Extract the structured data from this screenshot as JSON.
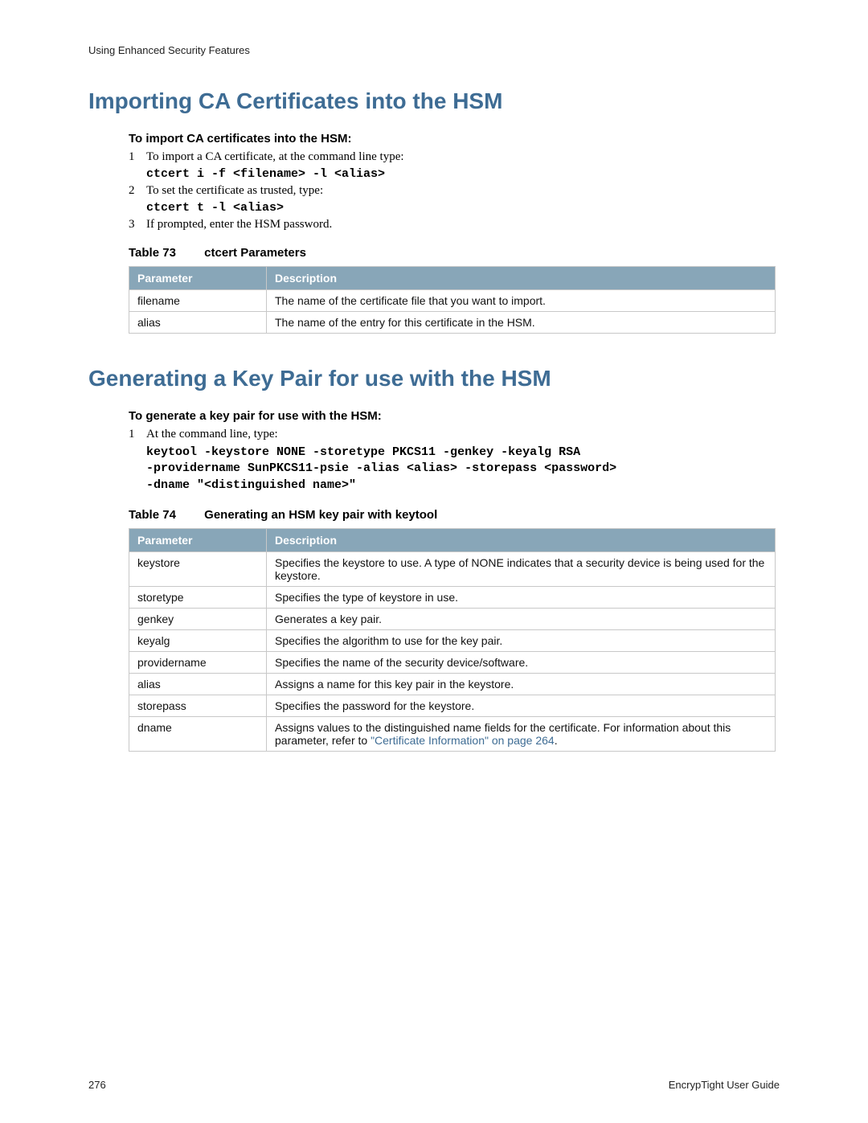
{
  "header": "Using Enhanced Security Features",
  "section1": {
    "title": "Importing CA Certificates into the HSM",
    "intro": "To import CA certificates into the HSM:",
    "steps": [
      {
        "n": "1",
        "text": "To import a CA certificate, at the command line type:"
      },
      {
        "n": "2",
        "text": "To set the certificate as trusted, type:"
      },
      {
        "n": "3",
        "text": "If prompted, enter the HSM password."
      }
    ],
    "code1": "ctcert i -f <filename> -l <alias>",
    "code2": "ctcert t -l <alias>",
    "tableCaptionNum": "Table 73",
    "tableCaptionText": "ctcert Parameters",
    "th1": "Parameter",
    "th2": "Description",
    "rows": [
      {
        "p": "filename",
        "d": "The name of the certificate file that you want to import."
      },
      {
        "p": "alias",
        "d": "The name of the entry for this certificate in the HSM."
      }
    ]
  },
  "section2": {
    "title": "Generating a Key Pair for use with the HSM",
    "intro": "To generate a key pair for use with the HSM:",
    "step1n": "1",
    "step1text": "At the command line, type:",
    "code": "keytool -keystore NONE -storetype PKCS11 -genkey -keyalg RSA\n-providername SunPKCS11-psie -alias <alias> -storepass <password>\n-dname \"<distinguished name>\"",
    "tableCaptionNum": "Table 74",
    "tableCaptionText": "Generating an HSM key pair with keytool",
    "th1": "Parameter",
    "th2": "Description",
    "rows": [
      {
        "p": "keystore",
        "d": "Specifies the keystore to use. A type of NONE indicates that a security device is being used for the keystore."
      },
      {
        "p": "storetype",
        "d": "Specifies the type of keystore in use."
      },
      {
        "p": "genkey",
        "d": "Generates a key pair."
      },
      {
        "p": "keyalg",
        "d": "Specifies the algorithm to use for the key pair."
      },
      {
        "p": "providername",
        "d": "Specifies the name of the security device/software."
      },
      {
        "p": "alias",
        "d": "Assigns a name for this key pair in the keystore."
      },
      {
        "p": "storepass",
        "d": "Specifies the password for the keystore."
      }
    ],
    "dname": {
      "p": "dname",
      "d_pre": "Assigns values to the distinguished name fields for the certificate. For information about this parameter, refer to ",
      "d_link": "\"Certificate Information\" on page 264",
      "d_post": "."
    }
  },
  "footer": {
    "pageNum": "276",
    "docTitle": "EncrypTight User Guide"
  }
}
